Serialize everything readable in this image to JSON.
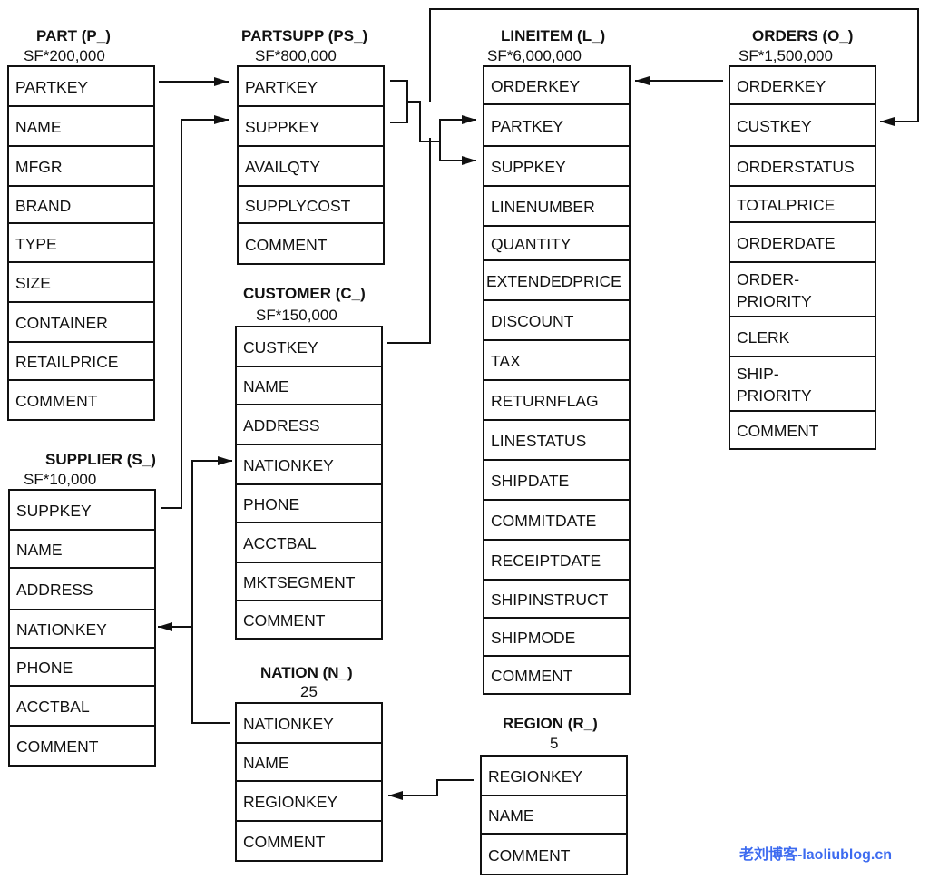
{
  "tables": [
    {
      "id": "part",
      "title": "PART (P_)",
      "cardinality": "SF*200,000",
      "columns": [
        "PARTKEY",
        "NAME",
        "MFGR",
        "BRAND",
        "TYPE",
        "SIZE",
        "CONTAINER",
        "RETAILPRICE",
        "COMMENT"
      ]
    },
    {
      "id": "partsupp",
      "title": "PARTSUPP (PS_)",
      "cardinality": "SF*800,000",
      "columns": [
        "PARTKEY",
        "SUPPKEY",
        "AVAILQTY",
        "SUPPLYCOST",
        "COMMENT"
      ]
    },
    {
      "id": "lineitem",
      "title": "LINEITEM (L_)",
      "cardinality": "SF*6,000,000",
      "columns": [
        "ORDERKEY",
        "PARTKEY",
        "SUPPKEY",
        "LINENUMBER",
        "QUANTITY",
        "EXTENDEDPRICE",
        "DISCOUNT",
        "TAX",
        "RETURNFLAG",
        "LINESTATUS",
        "SHIPDATE",
        "COMMITDATE",
        "RECEIPTDATE",
        "SHIPINSTRUCT",
        "SHIPMODE",
        "COMMENT"
      ]
    },
    {
      "id": "orders",
      "title": "ORDERS (O_)",
      "cardinality": "SF*1,500,000",
      "columns": [
        "ORDERKEY",
        "CUSTKEY",
        "ORDERSTATUS",
        "TOTALPRICE",
        "ORDERDATE",
        "ORDER-\nPRIORITY",
        "CLERK",
        "SHIP-\nPRIORITY",
        "COMMENT"
      ]
    },
    {
      "id": "customer",
      "title": "CUSTOMER (C_)",
      "cardinality": "SF*150,000",
      "columns": [
        "CUSTKEY",
        "NAME",
        "ADDRESS",
        "NATIONKEY",
        "PHONE",
        "ACCTBAL",
        "MKTSEGMENT",
        "COMMENT"
      ]
    },
    {
      "id": "supplier",
      "title": "SUPPLIER (S_)",
      "cardinality": "SF*10,000",
      "columns": [
        "SUPPKEY",
        "NAME",
        "ADDRESS",
        "NATIONKEY",
        "PHONE",
        "ACCTBAL",
        "COMMENT"
      ]
    },
    {
      "id": "nation",
      "title": "NATION (N_)",
      "cardinality": "25",
      "columns": [
        "NATIONKEY",
        "NAME",
        "REGIONKEY",
        "COMMENT"
      ]
    },
    {
      "id": "region",
      "title": "REGION (R_)",
      "cardinality": "5",
      "columns": [
        "REGIONKEY",
        "NAME",
        "COMMENT"
      ]
    }
  ],
  "relationships": [
    {
      "from": "part.PARTKEY",
      "to": "partsupp.PARTKEY"
    },
    {
      "from": "supplier.SUPPKEY",
      "to": "partsupp.SUPPKEY"
    },
    {
      "from": "partsupp.PARTKEY",
      "to": "lineitem.PARTKEY"
    },
    {
      "from": "partsupp.SUPPKEY",
      "to": "lineitem.SUPPKEY"
    },
    {
      "from": "orders.ORDERKEY",
      "to": "lineitem.ORDERKEY"
    },
    {
      "from": "customer.CUSTKEY",
      "to": "orders.CUSTKEY"
    },
    {
      "from": "nation.NATIONKEY",
      "to": "customer.NATIONKEY"
    },
    {
      "from": "nation.NATIONKEY",
      "to": "supplier.NATIONKEY"
    },
    {
      "from": "region.REGIONKEY",
      "to": "nation.REGIONKEY"
    }
  ],
  "watermark": "老刘博客-laoliublog.cn"
}
